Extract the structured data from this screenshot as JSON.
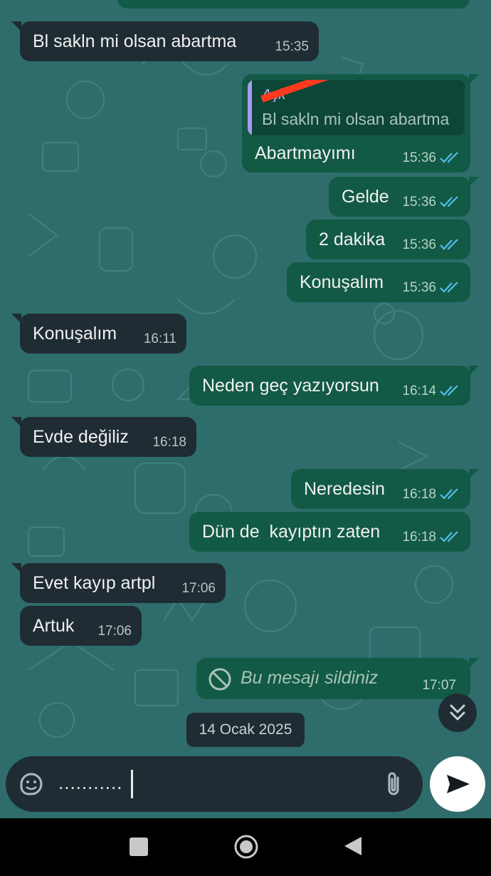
{
  "messages": [
    {
      "dir": "in",
      "text": "Bl sakln mi olsan abartma",
      "time": "15:35"
    },
    {
      "dir": "out",
      "reply_to": {
        "author": "Açk",
        "text": "Bl sakln mi olsan abartma"
      },
      "text": "Abartmayımı",
      "time": "15:36",
      "read": true
    },
    {
      "dir": "out",
      "text": "Gelde",
      "time": "15:36",
      "read": true
    },
    {
      "dir": "out",
      "text": "2 dakika",
      "time": "15:36",
      "read": true
    },
    {
      "dir": "out",
      "text": "Konuşalım",
      "time": "15:36",
      "read": true
    },
    {
      "dir": "in",
      "text": "Konuşalım",
      "time": "16:11"
    },
    {
      "dir": "out",
      "text": "Neden geç yazıyorsun",
      "time": "16:14",
      "read": true
    },
    {
      "dir": "in",
      "text": "Evde değiliz",
      "time": "16:18"
    },
    {
      "dir": "out",
      "text": "Neredesin",
      "time": "16:18",
      "read": true
    },
    {
      "dir": "out",
      "text": "Dün de  kayıptın zaten",
      "time": "16:18",
      "read": true
    },
    {
      "dir": "in",
      "text": "Evet kayıp artpl",
      "time": "17:06"
    },
    {
      "dir": "in",
      "text": "Artuk",
      "time": "17:06"
    },
    {
      "dir": "out",
      "deleted": true,
      "text": "Bu mesajı sildiniz",
      "time": "17:07"
    }
  ],
  "date_separator": "14 Ocak 2025",
  "composer": {
    "value": "...........",
    "icons": [
      "sticker-icon",
      "attach-icon",
      "send-icon"
    ]
  },
  "scroll_button_icon": "double-chevron-down-icon",
  "nav": [
    "recents-square-icon",
    "home-circle-icon",
    "back-triangle-icon"
  ],
  "colors": {
    "background": "#2e6d6c",
    "incoming": "#1f2c33",
    "outgoing": "#125a45",
    "read_ticks": "#53bdeb",
    "reply_accent": "#a99cf2",
    "redaction": "#ff3a1e"
  }
}
